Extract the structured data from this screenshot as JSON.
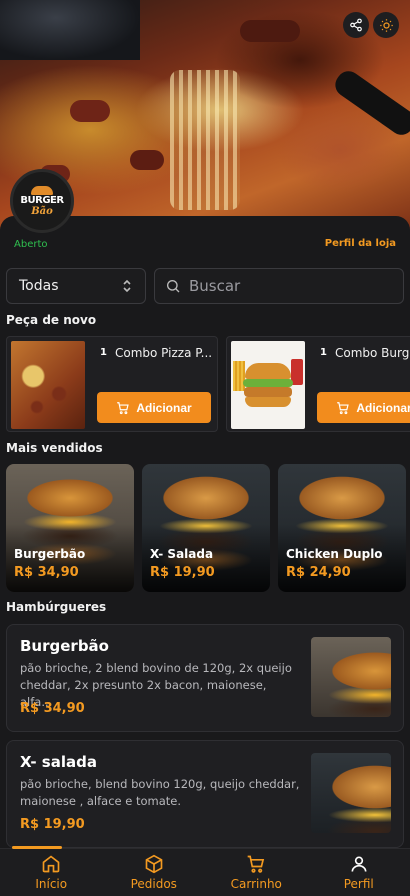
{
  "store": {
    "status": "Aberto",
    "profile_link": "Perfil da loja",
    "logo_line1": "BURGER",
    "logo_line2": "Bão"
  },
  "filters": {
    "category_value": "Todas",
    "search_placeholder": "Buscar"
  },
  "reorder": {
    "title": "Peça de novo",
    "items": [
      {
        "qty": "1",
        "name": "Combo Pizza P...",
        "button": "Adicionar"
      },
      {
        "qty": "1",
        "name": "Combo Burg...",
        "button": "Adicionar"
      }
    ]
  },
  "best_sellers": {
    "title": "Mais vendidos",
    "items": [
      {
        "name": "Burgerbão",
        "price": "R$ 34,90"
      },
      {
        "name": "X- Salada",
        "price": "R$ 19,90"
      },
      {
        "name": "Chicken Duplo",
        "price": "R$ 24,90"
      }
    ]
  },
  "burgers": {
    "title": "Hambúrgueres",
    "items": [
      {
        "name": "Burgerbão",
        "description": "pão brioche, 2 blend bovino de 120g, 2x queijo cheddar, 2x presunto 2x bacon, maionese, alfa...",
        "price": "R$ 34,90"
      },
      {
        "name": "X- salada",
        "description": "pão brioche, blend bovino 120g, queijo cheddar, maionese , alface e tomate.",
        "price": "R$ 19,90"
      }
    ]
  },
  "nav": {
    "items": [
      {
        "label": "Início",
        "icon": "home-icon"
      },
      {
        "label": "Pedidos",
        "icon": "box-icon"
      },
      {
        "label": "Carrinho",
        "icon": "cart-icon"
      },
      {
        "label": "Perfil",
        "icon": "user-icon"
      }
    ]
  },
  "colors": {
    "accent": "#f39a21",
    "open_status": "#2fbf4f",
    "background": "#19191b"
  }
}
